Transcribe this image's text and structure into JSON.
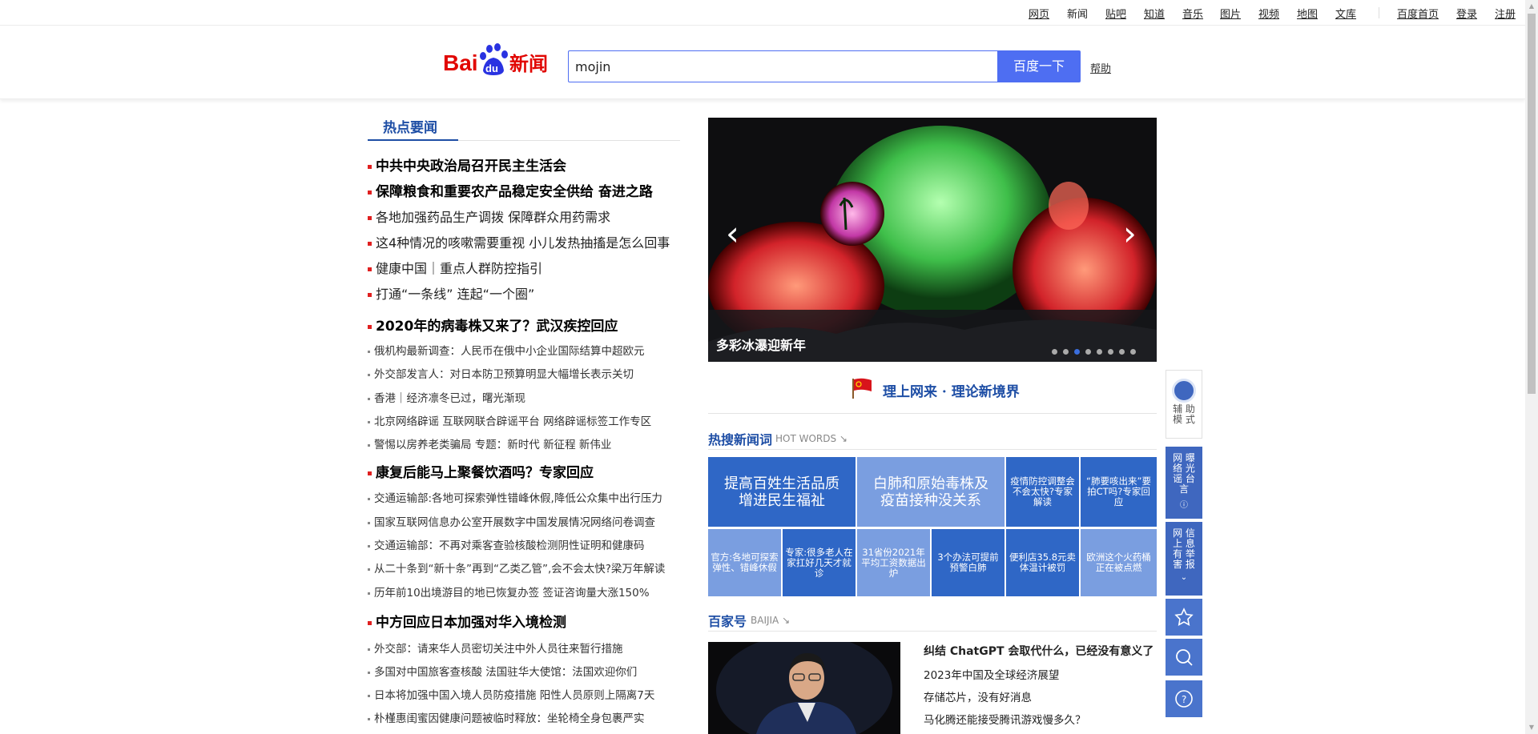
{
  "topnav": {
    "links": [
      "网页",
      "新闻",
      "贴吧",
      "知道",
      "音乐",
      "图片",
      "视频",
      "地图",
      "文库"
    ],
    "right_links": [
      "百度首页",
      "登录",
      "注册"
    ]
  },
  "header": {
    "logo_text_bai": "Bai",
    "logo_text_du": "du",
    "logo_text_news": "新闻",
    "search_value": "mojin",
    "search_button": "百度一下",
    "help": "帮助"
  },
  "hot": {
    "tab": "热点要闻",
    "items": [
      {
        "text": "中共中央政治局召开民主生活会",
        "style": "big"
      },
      {
        "text": "保障粮食和重要农产品稳定安全供给  奋进之路",
        "style": "big"
      },
      {
        "text": "各地加强药品生产调拨  保障群众用药需求",
        "style": "mid"
      },
      {
        "text": "这4种情况的咳嗽需要重视  小儿发热抽搐是怎么回事",
        "style": "mid"
      },
      {
        "text": "健康中国｜重点人群防控指引",
        "style": "mid"
      },
      {
        "text": "打通“一条线”  连起“一个圈”",
        "style": "mid"
      },
      {
        "text": "2020年的病毒株又来了？武汉疾控回应",
        "style": "big"
      },
      {
        "text": "俄机构最新调查：人民币在俄中小企业国际结算中超欧元",
        "style": "small"
      },
      {
        "text": "外交部发言人：对日本防卫预算明显大幅增长表示关切",
        "style": "small"
      },
      {
        "text": "香港｜经济凛冬已过，曙光渐现",
        "style": "small"
      },
      {
        "text": "北京网络辟谣 互联网联合辟谣平台 网络辟谣标签工作专区",
        "style": "small"
      },
      {
        "text": "警惕以房养老类骗局 专题：新时代 新征程 新伟业",
        "style": "small"
      },
      {
        "text": "康复后能马上聚餐饮酒吗？专家回应",
        "style": "big"
      },
      {
        "text": "交通运输部:各地可探索弹性错峰休假,降低公众集中出行压力",
        "style": "small"
      },
      {
        "text": "国家互联网信息办公室开展数字中国发展情况网络问卷调查",
        "style": "small"
      },
      {
        "text": "交通运输部：不再对乘客查验核酸检测阴性证明和健康码",
        "style": "small"
      },
      {
        "text": "从二十条到“新十条”再到“乙类乙管”,会不会太快?梁万年解读",
        "style": "small"
      },
      {
        "text": "历年前10出境游目的地已恢复办签 签证咨询量大涨150%",
        "style": "small"
      },
      {
        "text": "中方回应日本加强对华入境检测",
        "style": "big"
      },
      {
        "text": "外交部：请来华人员密切关注中外人员往来暂行措施",
        "style": "small"
      },
      {
        "text": "多国对中国旅客查核酸 法国驻华大使馆：法国欢迎你们",
        "style": "small"
      },
      {
        "text": "日本将加强中国入境人员防疫措施 阳性人员原则上隔离7天",
        "style": "small"
      },
      {
        "text": "朴槿惠闺蜜因健康问题被临时释放：坐轮椅全身包裹严实",
        "style": "small"
      }
    ]
  },
  "slider": {
    "caption": "多彩冰瀑迎新年",
    "prev": "‹",
    "next": "›",
    "dot_count": 8,
    "active_dot": 2
  },
  "banner": {
    "text": "理上网来 · 理论新境界"
  },
  "hotwords": {
    "title": "热搜新闻词",
    "sub": "HOT WORDS ↘",
    "big_cells": [
      "提高百姓生活品质增进民生福祉",
      "白肺和原始毒株及疫苗接种没关系"
    ],
    "top_small": [
      "疫情防控调整会不会太快?专家解读",
      "“肺要咳出来”要拍CT吗?专家回应"
    ],
    "bottom_small": [
      "官方:各地可探索弹性、错峰休假",
      "专家:很多老人在家扛好几天才就诊",
      "31省份2021年平均工资数据出炉",
      "3个办法可提前预警白肺",
      "便利店35.8元卖体温计被罚",
      "欧洲这个火药桶正在被点燃"
    ]
  },
  "baijia": {
    "title": "百家号",
    "sub": "BAIJIA ↘",
    "items": [
      "纠结 ChatGPT 会取代什么，已经没有意义了",
      "2023年中国及全球经济展望",
      "存储芯片，没有好消息",
      "马化腾还能接受腾讯游戏慢多久？"
    ]
  },
  "float": {
    "assist": "辅 助 模 式",
    "exposure": "网 曝 络 光 谣 台 言",
    "report": "网 信 上 息 有 举 害 报"
  },
  "colors": {
    "brand_blue": "#4e6ef2",
    "title_blue": "#1e4ea5",
    "bullet_red": "#e02020",
    "cell_dark": "#2f67c6",
    "cell_light": "#7a9ee0"
  }
}
